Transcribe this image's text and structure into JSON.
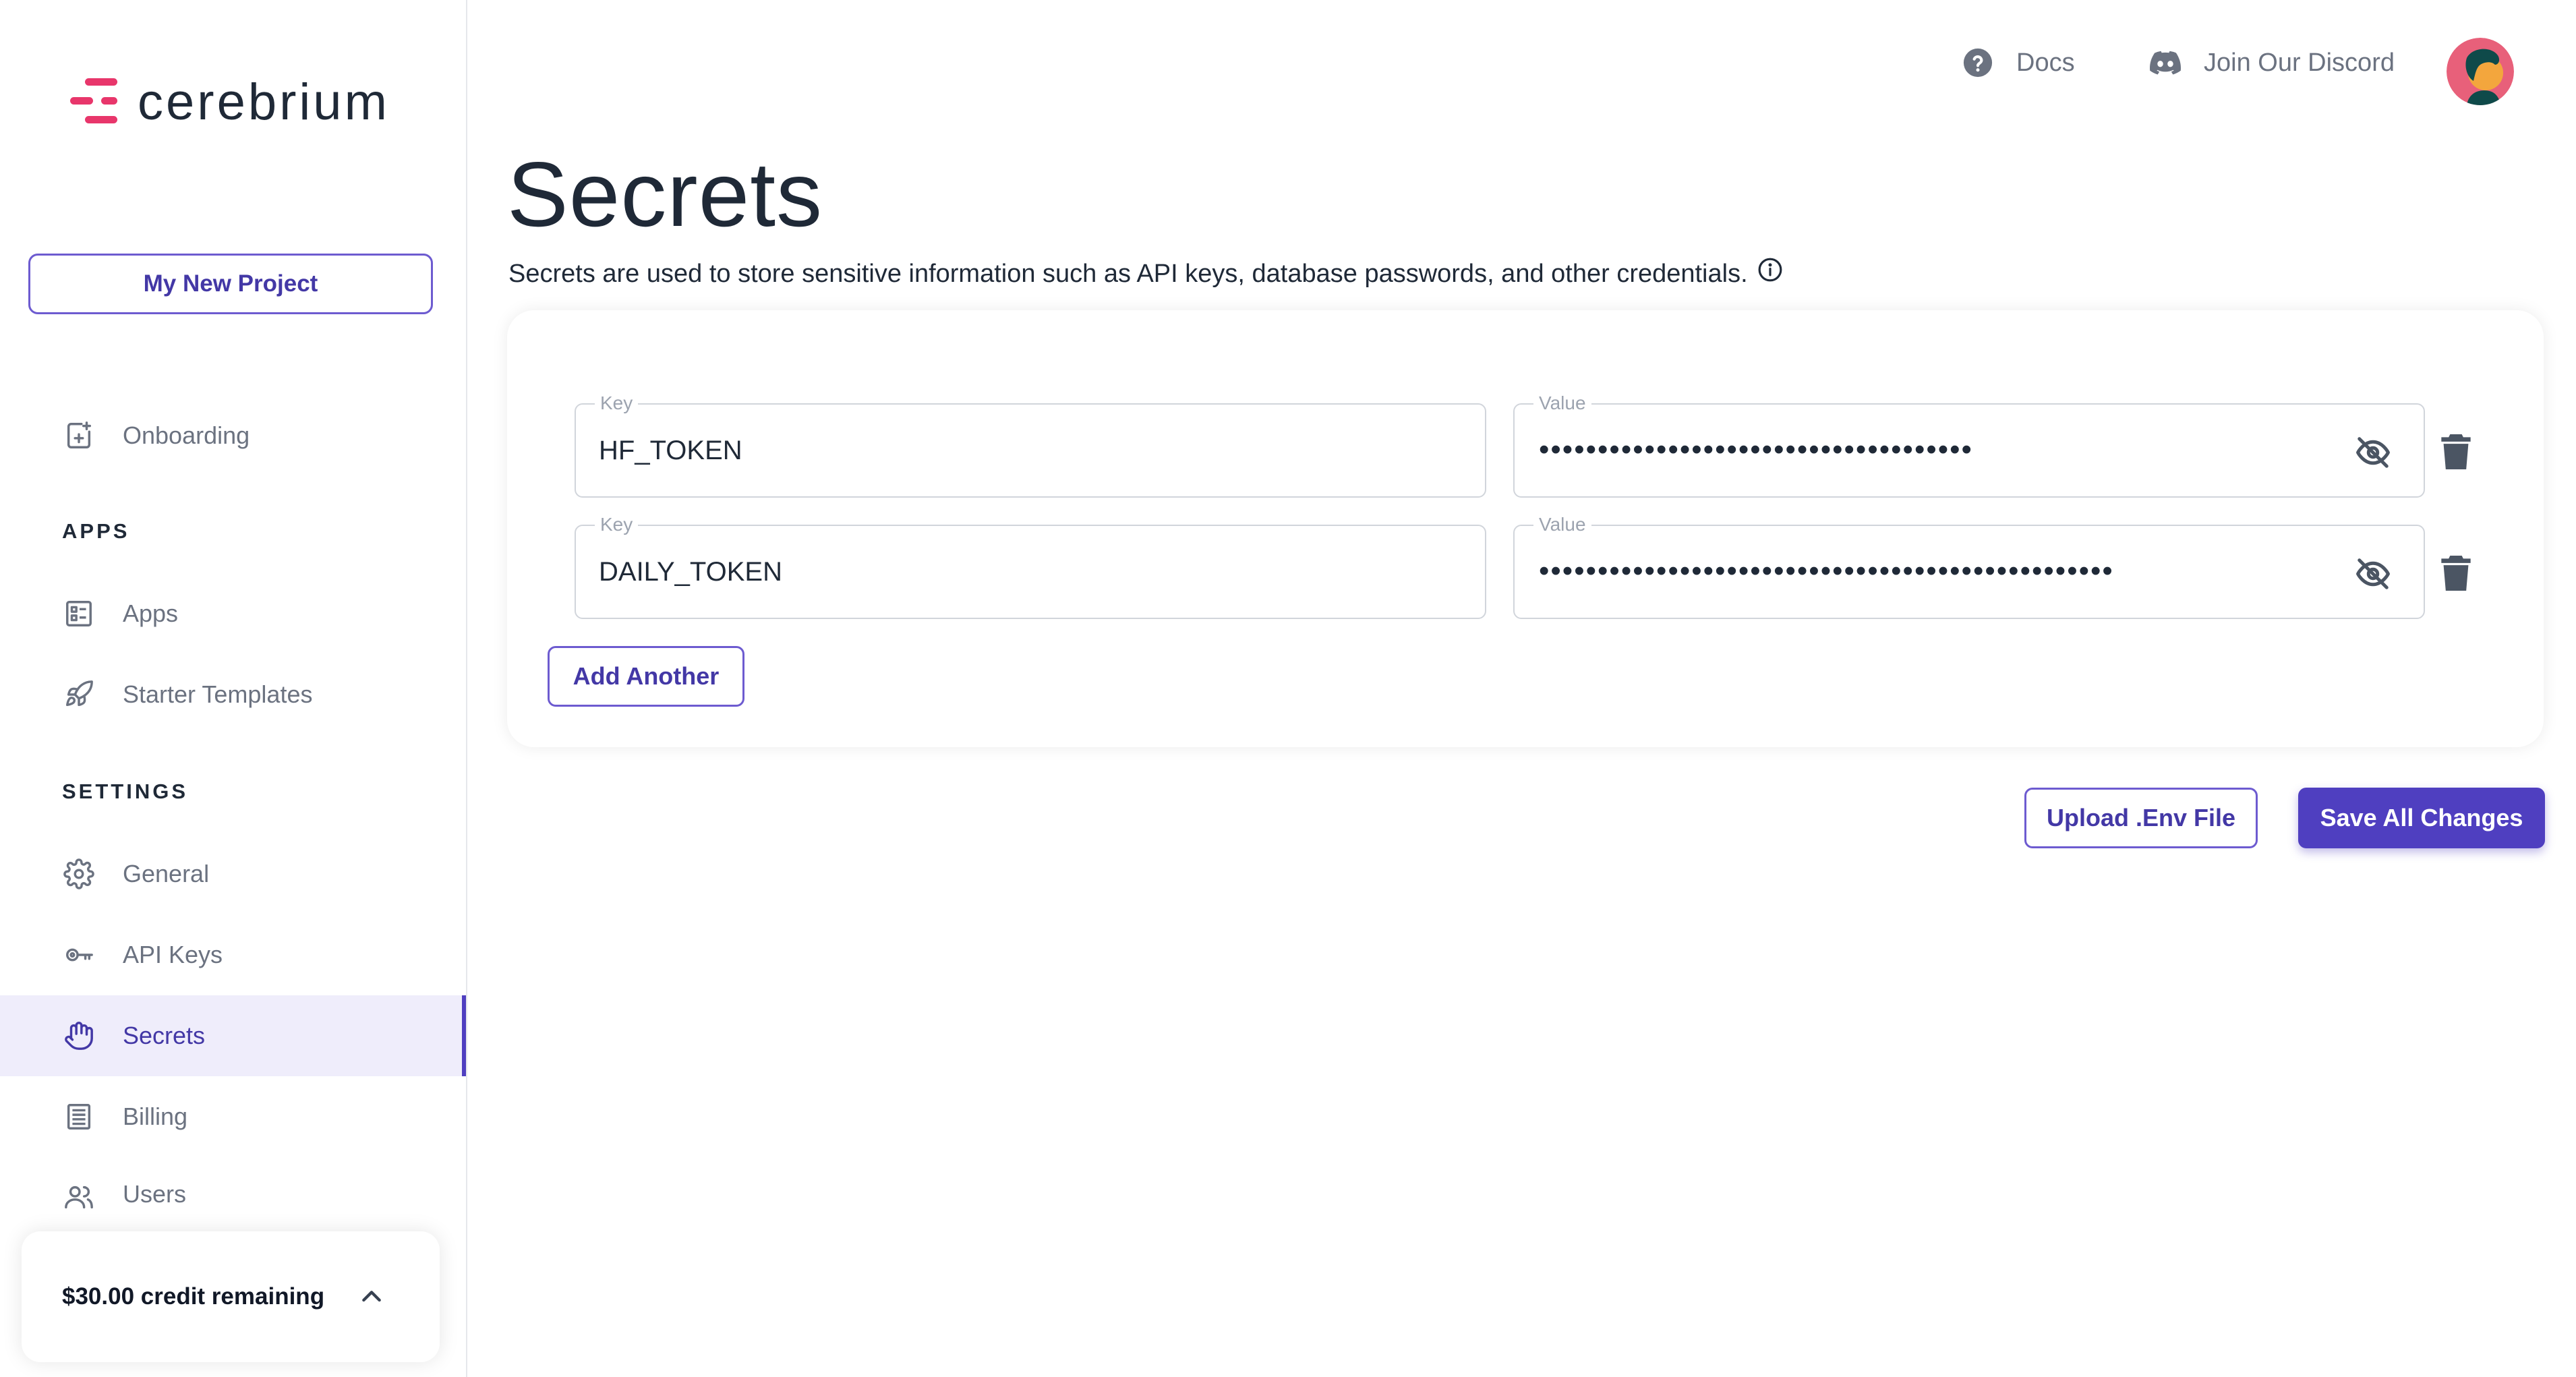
{
  "brand": {
    "name": "cerebrium",
    "accent": "#e8366b",
    "primary": "#4f3fc0"
  },
  "sidebar": {
    "project_button": "My New Project",
    "onboarding": {
      "label": "Onboarding",
      "icon": "onboarding-icon"
    },
    "apps_section": "APPS",
    "apps_items": [
      {
        "label": "Apps",
        "icon": "apps-icon"
      },
      {
        "label": "Starter Templates",
        "icon": "rocket-icon"
      }
    ],
    "settings_section": "SETTINGS",
    "settings_items": [
      {
        "label": "General",
        "icon": "gear-icon"
      },
      {
        "label": "API Keys",
        "icon": "key-icon"
      },
      {
        "label": "Secrets",
        "icon": "hand-icon",
        "active": true
      },
      {
        "label": "Billing",
        "icon": "billing-icon"
      },
      {
        "label": "Users",
        "icon": "users-icon"
      }
    ],
    "credit": {
      "text": "$30.00 credit remaining"
    }
  },
  "topbar": {
    "docs": "Docs",
    "discord": "Join Our Discord"
  },
  "main": {
    "title": "Secrets",
    "description": "Secrets are used to store sensitive information such as API keys, database passwords, and other credentials.",
    "secrets": [
      {
        "key_label": "Key",
        "key": "HF_TOKEN",
        "value_label": "Value",
        "masked_value": "•••••••••••••••••••••••••••••••••••••"
      },
      {
        "key_label": "Key",
        "key": "DAILY_TOKEN",
        "value_label": "Value",
        "masked_value": "•••••••••••••••••••••••••••••••••••••••••••••••••"
      }
    ],
    "add_another": "Add Another",
    "upload_env": "Upload .Env File",
    "save_all": "Save All Changes"
  }
}
